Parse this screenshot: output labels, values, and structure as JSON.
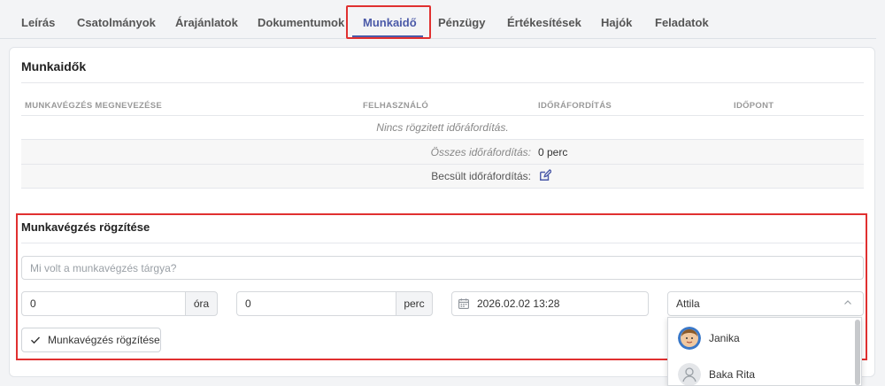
{
  "tabs": [
    {
      "label": "Leírás"
    },
    {
      "label": "Csatolmányok"
    },
    {
      "label": "Árajánlatok"
    },
    {
      "label": "Dokumentumok"
    },
    {
      "label": "Munkaidő",
      "active": true
    },
    {
      "label": "Pénzügy"
    },
    {
      "label": "Értékesítések"
    },
    {
      "label": "Hajók"
    },
    {
      "label": "Feladatok"
    }
  ],
  "worktimes": {
    "title": "Munkaidők",
    "columns": [
      "MUNKAVÉGZÉS MEGNEVEZÉSE",
      "FELHASZNÁLÓ",
      "IDŐRÁFORDÍTÁS",
      "IDŐPONT"
    ],
    "empty_message": "Nincs rögzitett időráfordítás.",
    "total_label": "Összes időráfordítás:",
    "total_value": "0 perc",
    "estimated_label": "Becsült időráfordítás:"
  },
  "form": {
    "title": "Munkavégzés rögzítése",
    "subject_placeholder": "Mi volt a munkavégzés tárgya?",
    "hours_value": "0",
    "hours_unit": "óra",
    "minutes_value": "0",
    "minutes_unit": "perc",
    "datetime_value": "2026.02.02 13:28",
    "user_selected": "Attila",
    "submit_label": "Munkavégzés rögzítése"
  },
  "user_dropdown": {
    "options": [
      "Janika",
      "Baka Rita"
    ]
  },
  "colors": {
    "accent": "#4a59a8",
    "highlight": "#e03030"
  }
}
